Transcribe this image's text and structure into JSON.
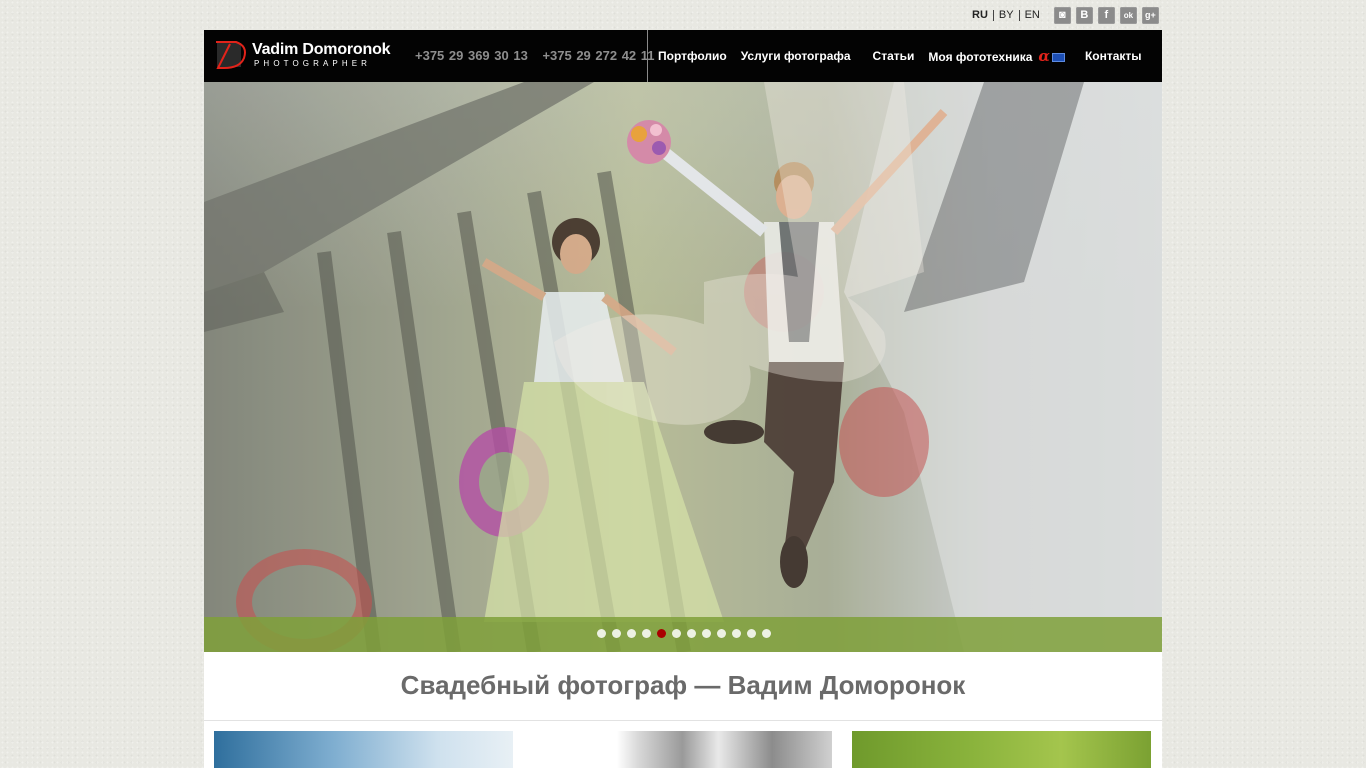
{
  "languages": [
    {
      "label": "RU",
      "active": true
    },
    {
      "label": "BY",
      "active": false
    },
    {
      "label": "EN",
      "active": false
    }
  ],
  "social": [
    {
      "name": "instagram-icon",
      "glyph": "◙"
    },
    {
      "name": "vk-icon",
      "glyph": "В"
    },
    {
      "name": "facebook-icon",
      "glyph": "f"
    },
    {
      "name": "odnoklassniki-icon",
      "glyph": "ok"
    },
    {
      "name": "google-plus-icon",
      "glyph": "g+"
    }
  ],
  "header": {
    "logo_name": "Vadim Domoronok",
    "logo_sub": "PHOTOGRAPHER",
    "phones": [
      "+375 29 369 30 13",
      "+375 29 272 42 11"
    ]
  },
  "nav": {
    "portfolio": "Портфолио",
    "services": "Услуги фотографа",
    "articles": "Статьи",
    "equipment": "Моя фототехника",
    "equipment_badge": "α",
    "contacts": "Контакты"
  },
  "slider": {
    "total_slides": 12,
    "active_slide": 5
  },
  "main": {
    "title": "Свадебный фотограф — Вадим Доморонок"
  },
  "colors": {
    "header_bg": "#030303",
    "accent": "#e2231a",
    "active_dot": "#aa0000",
    "title": "#6a6a6a"
  }
}
